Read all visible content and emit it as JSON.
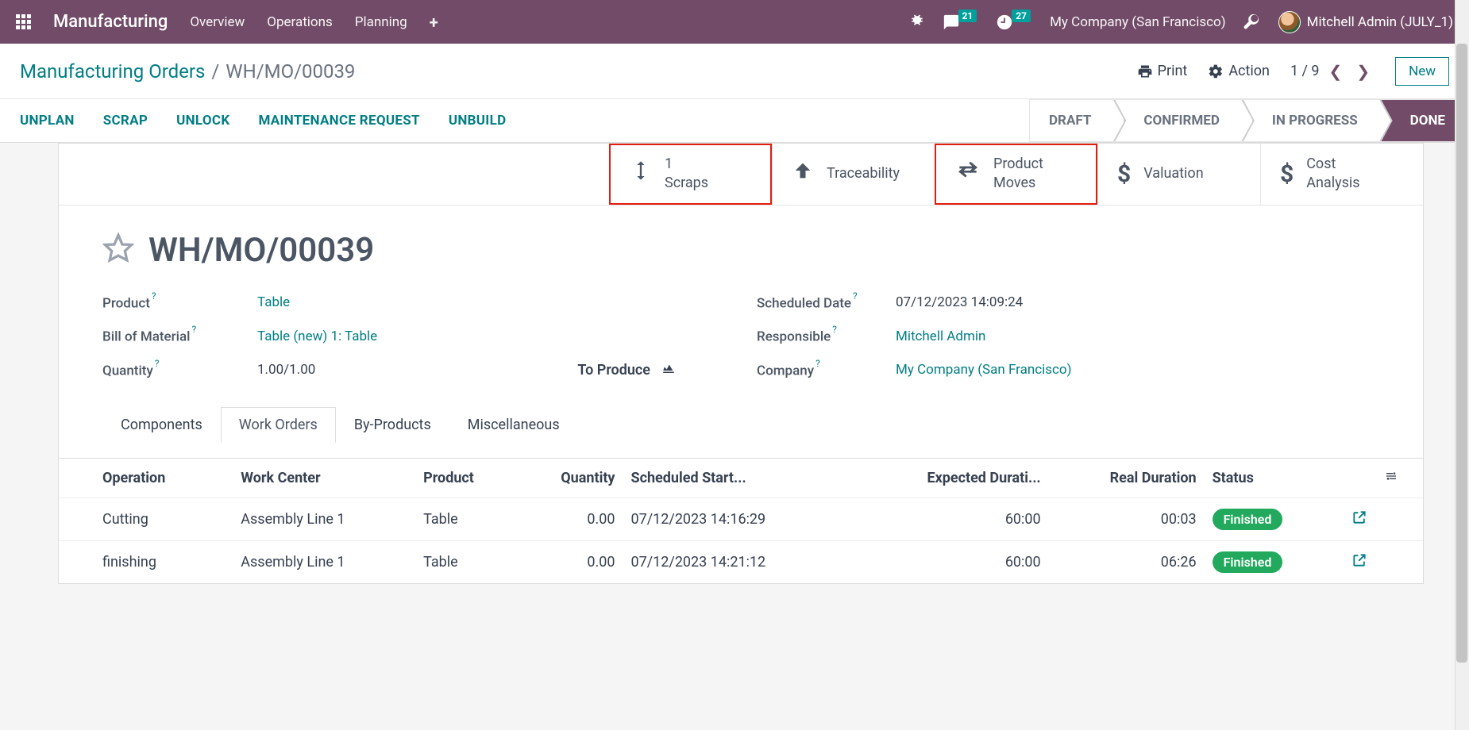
{
  "topbar": {
    "brand": "Manufacturing",
    "menu": [
      "Overview",
      "Operations",
      "Planning"
    ],
    "messages_badge": "21",
    "activities_badge": "27",
    "company": "My Company (San Francisco)",
    "user": "Mitchell Admin (JULY_1)"
  },
  "breadcrumb": {
    "parent": "Manufacturing Orders",
    "current": "WH/MO/00039",
    "print": "Print",
    "action": "Action",
    "pager": "1 / 9",
    "new_btn": "New"
  },
  "statusbar": {
    "actions": [
      "UNPLAN",
      "SCRAP",
      "UNLOCK",
      "MAINTENANCE REQUEST",
      "UNBUILD"
    ],
    "steps": [
      "DRAFT",
      "CONFIRMED",
      "IN PROGRESS",
      "DONE"
    ],
    "active_step": "DONE"
  },
  "stat_buttons": {
    "scraps": {
      "count": "1",
      "label": "Scraps"
    },
    "traceability": {
      "label": "Traceability"
    },
    "product_moves": {
      "line1": "Product",
      "line2": "Moves"
    },
    "valuation": {
      "label": "Valuation"
    },
    "cost_analysis": {
      "line1": "Cost",
      "line2": "Analysis"
    }
  },
  "form": {
    "title": "WH/MO/00039",
    "left": {
      "product_label": "Product",
      "product_value": "Table",
      "bom_label": "Bill of Material",
      "bom_value": "Table (new) 1: Table",
      "qty_label": "Quantity",
      "qty_value": "1.00/1.00",
      "to_produce": "To Produce"
    },
    "right": {
      "scheduled_label": "Scheduled Date",
      "scheduled_value": "07/12/2023 14:09:24",
      "responsible_label": "Responsible",
      "responsible_value": "Mitchell Admin",
      "company_label": "Company",
      "company_value": "My Company (San Francisco)"
    }
  },
  "tabs": [
    "Components",
    "Work Orders",
    "By-Products",
    "Miscellaneous"
  ],
  "active_tab": "Work Orders",
  "work_orders": {
    "headers": {
      "operation": "Operation",
      "work_center": "Work Center",
      "product": "Product",
      "quantity": "Quantity",
      "scheduled_start": "Scheduled Start...",
      "expected_duration": "Expected Durati...",
      "real_duration": "Real Duration",
      "status": "Status"
    },
    "rows": [
      {
        "operation": "Cutting",
        "work_center": "Assembly Line 1",
        "product": "Table",
        "quantity": "0.00",
        "scheduled_start": "07/12/2023 14:16:29",
        "expected_duration": "60:00",
        "real_duration": "00:03",
        "status": "Finished"
      },
      {
        "operation": "finishing",
        "work_center": "Assembly Line 1",
        "product": "Table",
        "quantity": "0.00",
        "scheduled_start": "07/12/2023 14:21:12",
        "expected_duration": "60:00",
        "real_duration": "06:26",
        "status": "Finished"
      }
    ]
  }
}
